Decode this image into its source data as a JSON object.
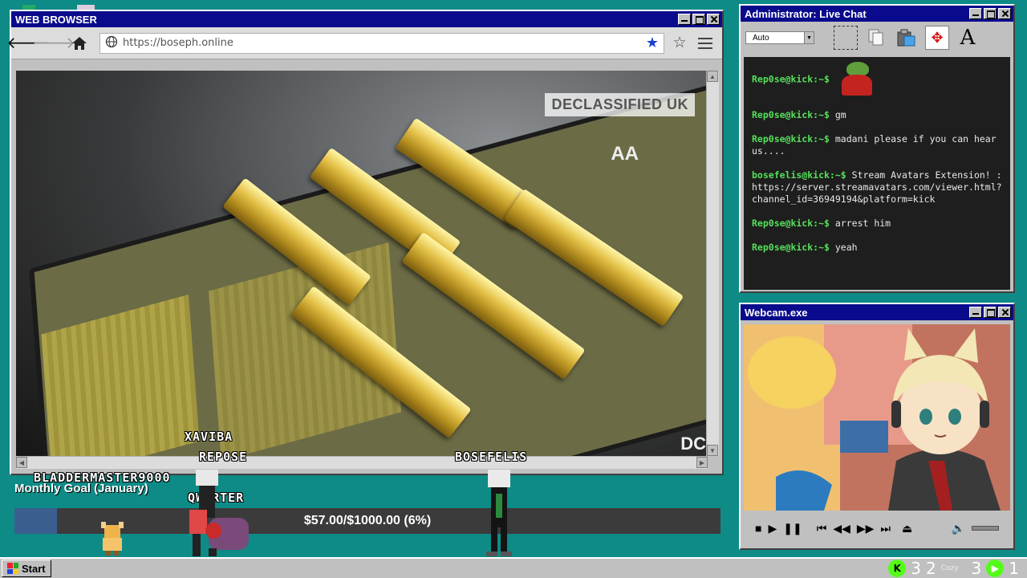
{
  "browser": {
    "title": "WEB BROWSER",
    "url": "https://boseph.online",
    "video": {
      "watermark": "DECLASSIFIED UK",
      "logo_aa": "AA",
      "logo_dc": "DC"
    }
  },
  "chat": {
    "title": "Administrator: Live Chat",
    "font_select": "Auto",
    "messages": [
      {
        "user": "Rep0se@kick:~$",
        "text": "",
        "has_emote": true
      },
      {
        "user": "Rep0se@kick:~$",
        "text": "gm"
      },
      {
        "user": "Rep0se@kick:~$",
        "text": "madani please if you can hear us...."
      },
      {
        "user": "bosefelis@kick:~$",
        "text": "Stream Avatars Extension! : https://server.streamavatars.com/viewer.html?channel_id=36949194&platform=kick"
      },
      {
        "user": "Rep0se@kick:~$",
        "text": "arrest him"
      },
      {
        "user": "Rep0se@kick:~$",
        "text": "yeah"
      }
    ]
  },
  "webcam": {
    "title": "Webcam.exe"
  },
  "goal": {
    "title": "Monthly Goal (January)",
    "text": "$57.00/$1000.00 (6%)",
    "progress": 0.06
  },
  "avatars": {
    "xaviba": "XAVIBA",
    "rep0se": "REP0SE",
    "bladdermaster": "BLADDERMASTER9000",
    "qwarter": "QWARTER",
    "bosefelis": "BOSEFELIS"
  },
  "taskbar": {
    "start": "Start",
    "tray_a": "3",
    "tray_b": "2",
    "cozy": "Cozy",
    "tray_c": "3",
    "tray_d": "1"
  }
}
